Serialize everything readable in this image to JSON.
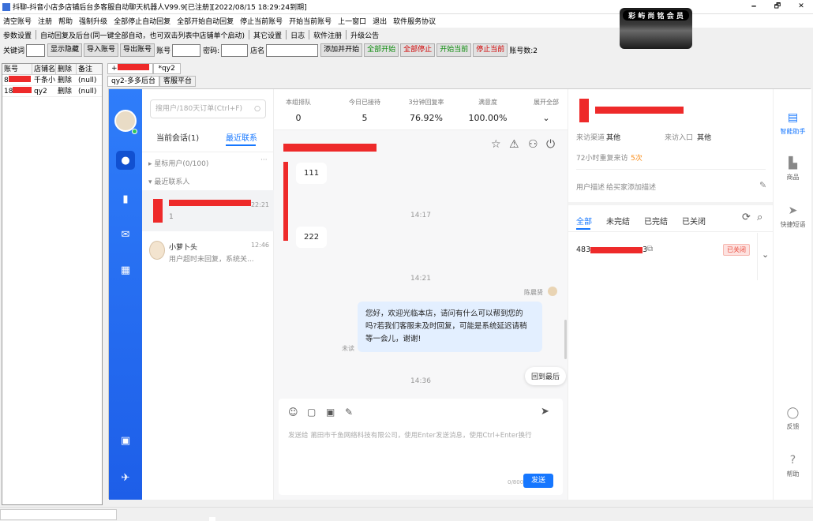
{
  "window": {
    "title": "抖聊-抖音小店多店铺后台多客服自动聊天机器人V99.9[已注册][2022/08/15 18:29:24到期]",
    "minimize": "🗕",
    "maximize": "🗗",
    "close": "✕"
  },
  "menu": [
    "清空账号",
    "注册",
    "帮助",
    "强制升级",
    "全部停止自动回复",
    "全部开始自动回复",
    "停止当前账号",
    "开始当前账号",
    "上一窗口",
    "退出",
    "软件服务协议"
  ],
  "logo_text": "彩 屿 尚 铭 会 员",
  "toolbar1": [
    "参数设置",
    "自动回复及后台(同一键全部自动，也可双击列表中店铺单个启动)",
    "其它设置",
    "日志",
    "软件注册",
    "升级公告"
  ],
  "toolbar2": {
    "keyword_label": "关键词",
    "show_hide": "显示隐藏",
    "import": "导入账号",
    "export": "导出账号",
    "account_label": "账号",
    "password_label": "密码:",
    "shop_label": "店名",
    "add_start": "添加并开始",
    "all_start": "全部开始",
    "all_stop": "全部停止",
    "start_current": "开始当前",
    "stop_current": "停止当前",
    "account_count": "账号数:2"
  },
  "table": {
    "headers": [
      "账号",
      "店铺名",
      "删除",
      "备注"
    ],
    "rows": [
      {
        "account": "8",
        "shop": "千条小",
        "del": "删除",
        "note": "(null)"
      },
      {
        "account": "18",
        "shop": "qy2",
        "del": "删除",
        "note": "(null)"
      }
    ]
  },
  "tabs": {
    "top": [
      "+",
      "*qy2"
    ],
    "sub": [
      "qy2-多多后台",
      "客服平台"
    ]
  },
  "conv": {
    "search_placeholder": "搜用户/180天订单(Ctrl+F)",
    "tab_current": "当前会话(1)",
    "tab_recent": "最近联系",
    "group_star": "星标用户(0/100)",
    "group_recent": "最近联系人",
    "item1_time": "22:21",
    "item1_msg": "1",
    "item2_name": "小萝卜头",
    "item2_time": "12:46",
    "item2_msg": "用户超时未回复，系统关..."
  },
  "stats": [
    {
      "label": "本组排队",
      "value": "0"
    },
    {
      "label": "今日已接待",
      "value": "5"
    },
    {
      "label": "3分钟回复率",
      "value": "76.92%"
    },
    {
      "label": "满意度",
      "value": "100.00%"
    },
    {
      "label": "展开全部",
      "value": "⌄"
    }
  ],
  "chat": {
    "msg1": "111",
    "time1": "14:17",
    "msg2": "222",
    "time2": "14:21",
    "agent_name": "陈晨贤",
    "agent_msg": "您好，欢迎光临本店，请问有什么可以帮到您的吗?若我们客服未及时回复，可能是系统延迟请稍等一会儿，谢谢!",
    "read_status": "未读",
    "time3": "14:36",
    "back_latest": "回到最后",
    "input_placeholder": "发送给 莆田市千鱼网络科技有限公司，使用Enter发送消息，使用Ctrl+Enter换行",
    "counter": "0/800",
    "send": "发送"
  },
  "info": {
    "channel_label": "来访渠道",
    "channel_value": "其他",
    "entry_label": "来访入口",
    "entry_value": "其他",
    "revisit_label": "72小时重复来访",
    "revisit_value": "5次",
    "desc_label": "用户描述",
    "desc_value": "给买家添加描述",
    "order_tabs": [
      "全部",
      "未完结",
      "已完结",
      "已关闭"
    ],
    "order_prefix": "483",
    "order_suffix": "3",
    "order_status": "已关闭"
  },
  "tools": [
    "智能助手",
    "商品",
    "快捷短语",
    "反馈",
    "帮助"
  ],
  "colors": {
    "accent": "#1677ff",
    "redact": "#ee2a2a"
  }
}
